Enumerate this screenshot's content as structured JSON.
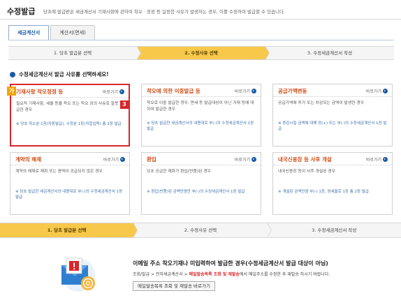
{
  "header": {
    "title": "수정발급",
    "description": "당초에 발급받은 세금계산서 기재사항에 관하여 착오ㆍ정정 등 일정한 사유가 발생하는 경우, 이를 수정하여 발급할 수 있습니다."
  },
  "tabs": [
    {
      "label": "세금계산서",
      "active": true
    },
    {
      "label": "계산서(면세)",
      "active": false
    }
  ],
  "steps_top": [
    {
      "label": "1. 당초 발급분 선택",
      "active": false
    },
    {
      "label": "2. 수정사유 선택",
      "active": true
    },
    {
      "label": "3. 수정세금계산서 작성",
      "active": false
    }
  ],
  "subheading": "수정세금계산서 발급 사유를 선택하세요!",
  "more_label": "바로가기",
  "cards": [
    {
      "title": "기재사항 착오정정 등",
      "body": "필요적 기재사항, 세율 등을 착오 또는 착오 외의 사유로 잘못 발급한 경우",
      "note": "※ 당초 취소분 1장(자동발급), 수정분 1장(직접입력) 총 2장 발급",
      "highlighted": true
    },
    {
      "title": "착오에 의한 이중발급 등",
      "body": "착오로 이중 발급한 경우, 면세 등 발급대상이 아닌 거래 등에 대하여 발급한 경우",
      "note": "※ 당초 발급한 세금계산서의 내용대로 부(-)의 수정세금계산서 1장 발급",
      "highlighted": false
    },
    {
      "title": "공급가액변동",
      "body": "공급가액에 추가 또는 차감되는 금액이 발생한 경우",
      "note": "※ 증감시킬 금액에 대해 정(+) 또는 부(-)의 수정세금계산서 1장 발급",
      "highlighted": false
    },
    {
      "title": "계약의 해제",
      "body": "계약의 해제로 재화 또는 용역이 공급되지 않은 경우",
      "note": "※ 당초 발급한 세금계산서의 내용대로 부(-)의 수정세금계산서 1장 발급",
      "highlighted": false
    },
    {
      "title": "환입",
      "body": "당초 공급한 재화가 환입(반품)된 경우",
      "note": "※ 환입(반품)된 금액만큼만 부(-)의 수정세금계산서 1장 발급",
      "highlighted": false
    },
    {
      "title": "내국신용장 등 사후 개설",
      "body": "내국신용장 등이 사후 개설된 경우",
      "note": "※ 개설된 금액만큼 부(-) 1장, 영세율로 1장 총 2장 발급",
      "highlighted": false
    }
  ],
  "markers": {
    "ga": "가",
    "three": "3"
  },
  "steps_bottom": [
    {
      "label": "1. 당초 발급분 선택",
      "active": true
    },
    {
      "label": "2. 수정사유 선택",
      "active": false
    },
    {
      "label": "3. 수정세금계산서 작성",
      "active": false
    }
  ],
  "bottom": {
    "title": "이메일 주소 착오기재나 미입력하여 발급한 경우(수정세금계산서 발급 대상이 아님)",
    "desc_prefix": "조회/발급 > 전자세금계산서 > ",
    "desc_red": "메일발송목록 조회 및 재발송",
    "desc_suffix": "에서 메일주소를 수정한 후 재발송 하시기 바랍니다.",
    "button": "메일발송목록 조회 및 재발송 바로가기"
  },
  "colors": {
    "accent": "#1a5aa6",
    "active_step": "#f7c84a",
    "card_title": "#d14a12",
    "highlight": "#d8262a"
  },
  "icons": [
    "go-arrow-icon",
    "mail-warning-icon"
  ]
}
